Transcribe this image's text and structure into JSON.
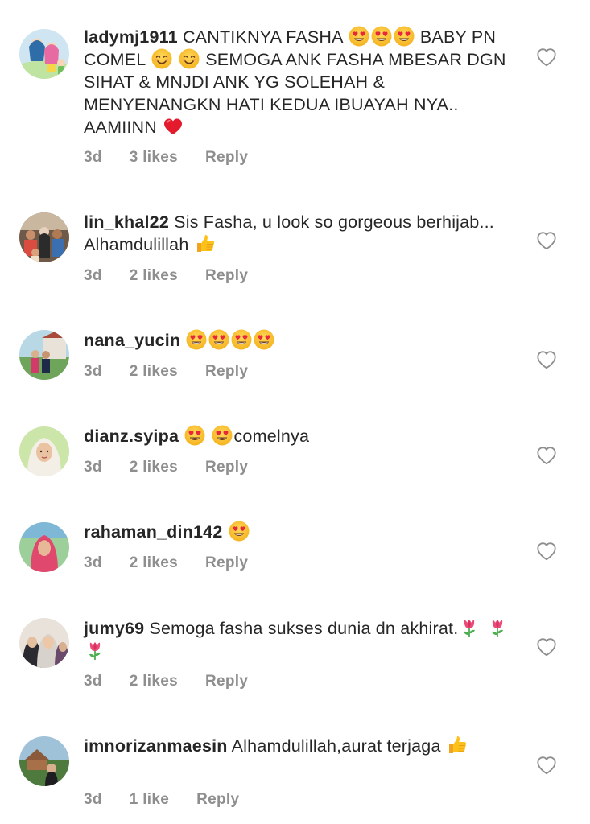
{
  "comments": [
    {
      "username": "ladymj1911",
      "text_parts": [
        "CANTIKNYA FASHA",
        "BABY PN COMEL",
        "SEMOGA ANK FASHA MBESAR DGN SIHAT & MNJDI ANK YG SOLEHAH & MENYENANGKN HATI KEDUA IBUAYAH NYA.. AAMIINN"
      ],
      "time": "3d",
      "likes": "3 likes",
      "reply": "Reply"
    },
    {
      "username": "lin_khal22",
      "text_parts": [
        "Sis Fasha, u look so gorgeous berhijab... Alhamdulillah"
      ],
      "time": "3d",
      "likes": "2 likes",
      "reply": "Reply"
    },
    {
      "username": "nana_yucin",
      "text_parts": [],
      "time": "3d",
      "likes": "2 likes",
      "reply": "Reply"
    },
    {
      "username": "dianz.syipa",
      "text_parts": [
        "comelnya"
      ],
      "time": "3d",
      "likes": "2 likes",
      "reply": "Reply"
    },
    {
      "username": "rahaman_din142",
      "text_parts": [],
      "time": "3d",
      "likes": "2 likes",
      "reply": "Reply"
    },
    {
      "username": "jumy69",
      "text_parts": [
        "Semoga fasha sukses dunia dn akhirat."
      ],
      "time": "3d",
      "likes": "2 likes",
      "reply": "Reply"
    },
    {
      "username": "imnorizanmaesin",
      "text_parts": [
        "Alhamdulillah,aurat terjaga"
      ],
      "time": "3d",
      "likes": "1 like",
      "reply": "Reply"
    }
  ],
  "colors": {
    "text": "#262626",
    "meta": "#8e8e8e",
    "heart_outline": "#8e8e8e"
  },
  "icons": {
    "like": "heart-outline-icon",
    "heart_eyes": "heart-eyes-emoji",
    "smile": "smiling-face-emoji",
    "red_heart": "red-heart-emoji",
    "thumbs_up": "thumbs-up-emoji",
    "tulip": "tulip-emoji"
  }
}
